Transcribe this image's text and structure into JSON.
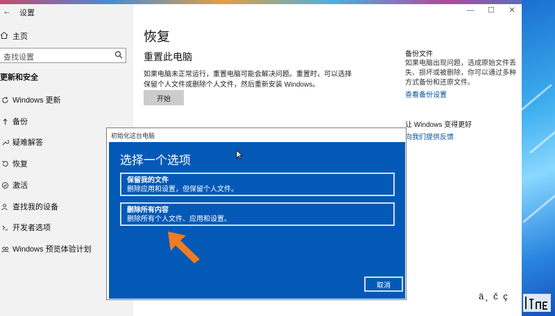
{
  "window": {
    "title": "设置",
    "back_glyph": "←"
  },
  "window_controls": {
    "minimize": "—",
    "maximize": "☐",
    "close": "✕"
  },
  "nav": {
    "home": "主页",
    "search_placeholder": "查找设置",
    "section": "更新和安全",
    "items": [
      {
        "label": "Windows 更新",
        "icon": "sync-icon"
      },
      {
        "label": "备份",
        "icon": "backup-icon"
      },
      {
        "label": "疑难解答",
        "icon": "wrench-icon"
      },
      {
        "label": "恢复",
        "icon": "recovery-icon"
      },
      {
        "label": "激活",
        "icon": "check-circle-icon"
      },
      {
        "label": "查找我的设备",
        "icon": "person-location-icon"
      },
      {
        "label": "开发者选项",
        "icon": "developer-icon"
      },
      {
        "label": "Windows 预览体验计划",
        "icon": "windows-insider-icon"
      }
    ]
  },
  "main": {
    "title": "恢复",
    "section_title": "重置此电脑",
    "description": "如果电脑未正常运行，重置电脑可能会解决问题。重置时，可以选择保留个人文件或删除个人文件，然后重新安装 Windows。",
    "start_button": "开始"
  },
  "side": {
    "backup_heading": "备份文件",
    "backup_text": "如果电脑出现问题，选成原始文件丢失、损坏或被删除，你可以通过多种方式备份和还原文件。",
    "backup_link": "查看备份设置",
    "improve_heading": "让 Windows 变得更好",
    "feedback_link": "向我们提供反馈"
  },
  "dialog": {
    "title": "初始化这台电脑",
    "heading": "选择一个选项",
    "options": [
      {
        "title": "保留我的文件",
        "subtitle": "删除应用和设置，但保留个人文件。"
      },
      {
        "title": "删除所有内容",
        "subtitle": "删除所有个人文件、应用和设置。"
      }
    ],
    "cancel": "取消"
  },
  "overlay": {
    "watermark": "ä¸ č ç"
  },
  "colors": {
    "dialog_blue": "#0559b6",
    "arrow_orange": "#f07c22",
    "link_blue": "#0050a0"
  }
}
